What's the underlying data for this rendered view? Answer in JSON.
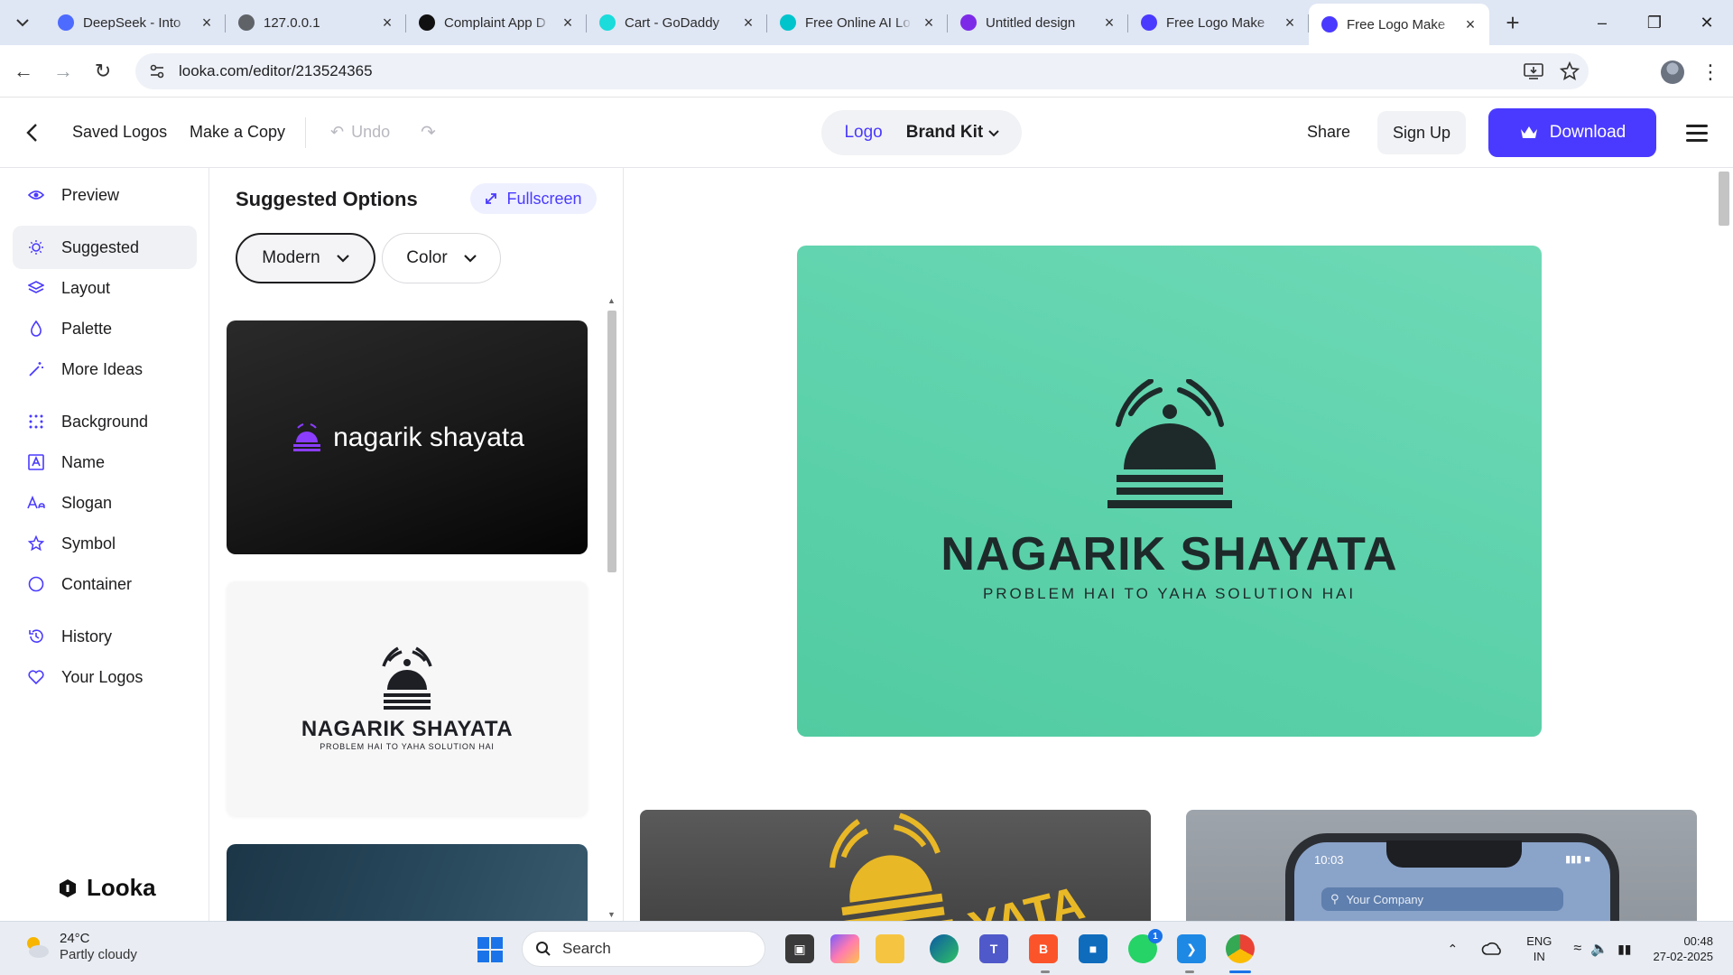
{
  "browser": {
    "tabs": [
      {
        "title": "DeepSeek - Into",
        "icon": "deepseek-icon",
        "color": "#4d6bfe"
      },
      {
        "title": "127.0.0.1",
        "icon": "globe-icon",
        "color": "#5f6368"
      },
      {
        "title": "Complaint App D",
        "icon": "openai-icon",
        "color": "#111111"
      },
      {
        "title": "Cart - GoDaddy",
        "icon": "godaddy-icon",
        "color": "#1bdbdb"
      },
      {
        "title": "Free Online AI Lo",
        "icon": "canva-icon",
        "color": "#00c4cc"
      },
      {
        "title": "Untitled design",
        "icon": "canva-icon",
        "color": "#7d2ae8"
      },
      {
        "title": "Free Logo Make",
        "icon": "looka-icon",
        "color": "#4a3aff"
      },
      {
        "title": "Free Logo Make",
        "icon": "looka-icon",
        "color": "#4a3aff",
        "active": true
      }
    ],
    "url": "looka.com/editor/213524365"
  },
  "header": {
    "saved_logos": "Saved Logos",
    "make_copy": "Make a Copy",
    "undo": "Undo",
    "seg_logo": "Logo",
    "seg_brand_kit": "Brand Kit",
    "share": "Share",
    "sign_up": "Sign Up",
    "download": "Download"
  },
  "nav": {
    "items": [
      {
        "label": "Preview",
        "icon": "eye-icon"
      },
      {
        "label": "Suggested",
        "icon": "lightbulb-icon",
        "active": true
      },
      {
        "label": "Layout",
        "icon": "layers-icon"
      },
      {
        "label": "Palette",
        "icon": "drop-icon"
      },
      {
        "label": "More Ideas",
        "icon": "magic-wand-icon"
      },
      {
        "label": "Background",
        "icon": "grid-dots-icon"
      },
      {
        "label": "Name",
        "icon": "text-box-icon"
      },
      {
        "label": "Slogan",
        "icon": "slogan-icon"
      },
      {
        "label": "Symbol",
        "icon": "star-icon"
      },
      {
        "label": "Container",
        "icon": "circle-icon"
      },
      {
        "label": "History",
        "icon": "history-icon"
      },
      {
        "label": "Your Logos",
        "icon": "heart-icon"
      }
    ],
    "brand": "Looka"
  },
  "suggestions": {
    "title": "Suggested Options",
    "fullscreen": "Fullscreen",
    "filter_style": "Modern",
    "filter_color": "Color",
    "card1_name": "nagarik shayata",
    "card2_name": "NAGARIK SHAYATA",
    "card2_slogan": "PROBLEM HAI TO YAHA SOLUTION HAI"
  },
  "main": {
    "logo_name": "NAGARIK SHAYATA",
    "logo_slogan": "PROBLEM HAI TO YAHA SOLUTION HAI",
    "hero_color": "#5ed2ab",
    "mock1_text": "YATA",
    "phone_time": "10:03",
    "phone_search": "Your Company"
  },
  "taskbar": {
    "temperature": "24°C",
    "condition": "Partly cloudy",
    "search": "Search",
    "lang1": "ENG",
    "lang2": "IN",
    "time": "00:48",
    "date": "27-02-2025",
    "whatsapp_badge": "1"
  },
  "colors": {
    "accent": "#4a3aff",
    "logo_dark": "#1e2a2a",
    "gold": "#e9b826"
  }
}
